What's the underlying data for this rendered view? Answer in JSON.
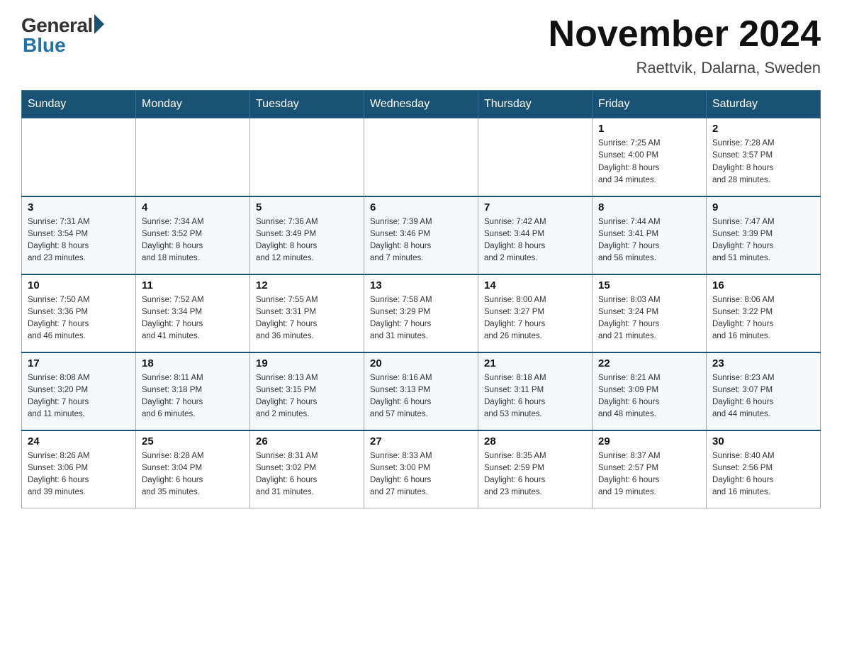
{
  "header": {
    "logo_general": "General",
    "logo_blue": "Blue",
    "month_title": "November 2024",
    "location": "Raettvik, Dalarna, Sweden"
  },
  "weekdays": [
    "Sunday",
    "Monday",
    "Tuesday",
    "Wednesday",
    "Thursday",
    "Friday",
    "Saturday"
  ],
  "weeks": [
    [
      {
        "day": "",
        "info": ""
      },
      {
        "day": "",
        "info": ""
      },
      {
        "day": "",
        "info": ""
      },
      {
        "day": "",
        "info": ""
      },
      {
        "day": "",
        "info": ""
      },
      {
        "day": "1",
        "info": "Sunrise: 7:25 AM\nSunset: 4:00 PM\nDaylight: 8 hours\nand 34 minutes."
      },
      {
        "day": "2",
        "info": "Sunrise: 7:28 AM\nSunset: 3:57 PM\nDaylight: 8 hours\nand 28 minutes."
      }
    ],
    [
      {
        "day": "3",
        "info": "Sunrise: 7:31 AM\nSunset: 3:54 PM\nDaylight: 8 hours\nand 23 minutes."
      },
      {
        "day": "4",
        "info": "Sunrise: 7:34 AM\nSunset: 3:52 PM\nDaylight: 8 hours\nand 18 minutes."
      },
      {
        "day": "5",
        "info": "Sunrise: 7:36 AM\nSunset: 3:49 PM\nDaylight: 8 hours\nand 12 minutes."
      },
      {
        "day": "6",
        "info": "Sunrise: 7:39 AM\nSunset: 3:46 PM\nDaylight: 8 hours\nand 7 minutes."
      },
      {
        "day": "7",
        "info": "Sunrise: 7:42 AM\nSunset: 3:44 PM\nDaylight: 8 hours\nand 2 minutes."
      },
      {
        "day": "8",
        "info": "Sunrise: 7:44 AM\nSunset: 3:41 PM\nDaylight: 7 hours\nand 56 minutes."
      },
      {
        "day": "9",
        "info": "Sunrise: 7:47 AM\nSunset: 3:39 PM\nDaylight: 7 hours\nand 51 minutes."
      }
    ],
    [
      {
        "day": "10",
        "info": "Sunrise: 7:50 AM\nSunset: 3:36 PM\nDaylight: 7 hours\nand 46 minutes."
      },
      {
        "day": "11",
        "info": "Sunrise: 7:52 AM\nSunset: 3:34 PM\nDaylight: 7 hours\nand 41 minutes."
      },
      {
        "day": "12",
        "info": "Sunrise: 7:55 AM\nSunset: 3:31 PM\nDaylight: 7 hours\nand 36 minutes."
      },
      {
        "day": "13",
        "info": "Sunrise: 7:58 AM\nSunset: 3:29 PM\nDaylight: 7 hours\nand 31 minutes."
      },
      {
        "day": "14",
        "info": "Sunrise: 8:00 AM\nSunset: 3:27 PM\nDaylight: 7 hours\nand 26 minutes."
      },
      {
        "day": "15",
        "info": "Sunrise: 8:03 AM\nSunset: 3:24 PM\nDaylight: 7 hours\nand 21 minutes."
      },
      {
        "day": "16",
        "info": "Sunrise: 8:06 AM\nSunset: 3:22 PM\nDaylight: 7 hours\nand 16 minutes."
      }
    ],
    [
      {
        "day": "17",
        "info": "Sunrise: 8:08 AM\nSunset: 3:20 PM\nDaylight: 7 hours\nand 11 minutes."
      },
      {
        "day": "18",
        "info": "Sunrise: 8:11 AM\nSunset: 3:18 PM\nDaylight: 7 hours\nand 6 minutes."
      },
      {
        "day": "19",
        "info": "Sunrise: 8:13 AM\nSunset: 3:15 PM\nDaylight: 7 hours\nand 2 minutes."
      },
      {
        "day": "20",
        "info": "Sunrise: 8:16 AM\nSunset: 3:13 PM\nDaylight: 6 hours\nand 57 minutes."
      },
      {
        "day": "21",
        "info": "Sunrise: 8:18 AM\nSunset: 3:11 PM\nDaylight: 6 hours\nand 53 minutes."
      },
      {
        "day": "22",
        "info": "Sunrise: 8:21 AM\nSunset: 3:09 PM\nDaylight: 6 hours\nand 48 minutes."
      },
      {
        "day": "23",
        "info": "Sunrise: 8:23 AM\nSunset: 3:07 PM\nDaylight: 6 hours\nand 44 minutes."
      }
    ],
    [
      {
        "day": "24",
        "info": "Sunrise: 8:26 AM\nSunset: 3:06 PM\nDaylight: 6 hours\nand 39 minutes."
      },
      {
        "day": "25",
        "info": "Sunrise: 8:28 AM\nSunset: 3:04 PM\nDaylight: 6 hours\nand 35 minutes."
      },
      {
        "day": "26",
        "info": "Sunrise: 8:31 AM\nSunset: 3:02 PM\nDaylight: 6 hours\nand 31 minutes."
      },
      {
        "day": "27",
        "info": "Sunrise: 8:33 AM\nSunset: 3:00 PM\nDaylight: 6 hours\nand 27 minutes."
      },
      {
        "day": "28",
        "info": "Sunrise: 8:35 AM\nSunset: 2:59 PM\nDaylight: 6 hours\nand 23 minutes."
      },
      {
        "day": "29",
        "info": "Sunrise: 8:37 AM\nSunset: 2:57 PM\nDaylight: 6 hours\nand 19 minutes."
      },
      {
        "day": "30",
        "info": "Sunrise: 8:40 AM\nSunset: 2:56 PM\nDaylight: 6 hours\nand 16 minutes."
      }
    ]
  ]
}
